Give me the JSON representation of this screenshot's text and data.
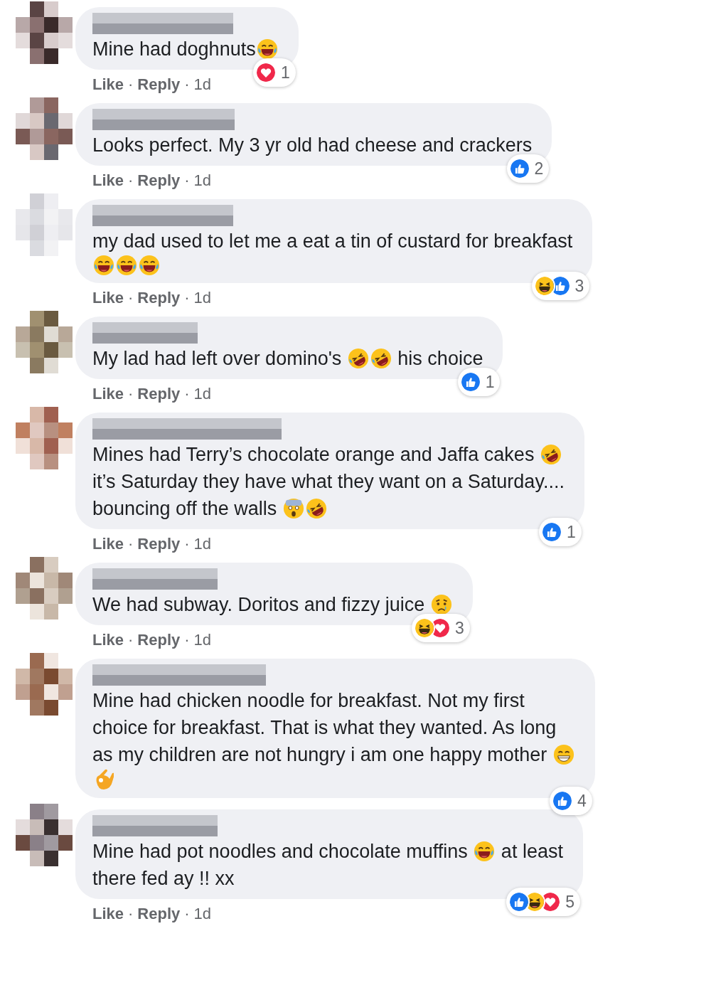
{
  "comments": [
    {
      "lines": [
        [
          {
            "kind": "text",
            "text": "Mine had doghnuts"
          },
          {
            "kind": "laugh"
          }
        ]
      ],
      "reactions": [
        {
          "kind": "love"
        }
      ],
      "count": "1",
      "meta": [
        {
          "kind": "link",
          "text": "Like"
        },
        {
          "kind": "sep",
          "text": "·"
        },
        {
          "kind": "link",
          "text": "Reply"
        },
        {
          "kind": "sep",
          "text": "·"
        },
        {
          "kind": "time",
          "text": "1d"
        }
      ]
    },
    {
      "lines": [
        [
          {
            "kind": "text",
            "text": "Looks perfect. My 3 yr old had cheese and crackers"
          }
        ]
      ],
      "reactions": [
        {
          "kind": "like"
        }
      ],
      "count": "2",
      "meta": [
        {
          "kind": "link",
          "text": "Like"
        },
        {
          "kind": "sep",
          "text": "·"
        },
        {
          "kind": "link",
          "text": "Reply"
        },
        {
          "kind": "sep",
          "text": "·"
        },
        {
          "kind": "time",
          "text": "1d"
        }
      ]
    },
    {
      "lines": [
        [
          {
            "kind": "text",
            "text": "my dad used to let me a eat a tin of custard for breakfast"
          }
        ],
        [
          {
            "kind": "laugh"
          },
          {
            "kind": "laugh"
          },
          {
            "kind": "laugh"
          }
        ]
      ],
      "reactions": [
        {
          "kind": "haha"
        },
        {
          "kind": "like"
        }
      ],
      "count": "3",
      "meta": [
        {
          "kind": "link",
          "text": "Like"
        },
        {
          "kind": "sep",
          "text": "·"
        },
        {
          "kind": "link",
          "text": "Reply"
        },
        {
          "kind": "sep",
          "text": "·"
        },
        {
          "kind": "time",
          "text": "1d"
        }
      ]
    },
    {
      "lines": [
        [
          {
            "kind": "text",
            "text": "My lad had left over domino's "
          },
          {
            "kind": "rofl"
          },
          {
            "kind": "rofl"
          },
          {
            "kind": "text",
            "text": " his choice"
          }
        ]
      ],
      "reactions": [
        {
          "kind": "like"
        }
      ],
      "count": "1",
      "meta": [
        {
          "kind": "link",
          "text": "Like"
        },
        {
          "kind": "sep",
          "text": "·"
        },
        {
          "kind": "link",
          "text": "Reply"
        },
        {
          "kind": "sep",
          "text": "·"
        },
        {
          "kind": "time",
          "text": "1d"
        }
      ]
    },
    {
      "lines": [
        [
          {
            "kind": "text",
            "text": "Mines had Terry’s chocolate orange and Jaffa cakes "
          },
          {
            "kind": "rofl"
          }
        ],
        [
          {
            "kind": "text",
            "text": "it’s Saturday they have what they want on a Saturday...."
          }
        ],
        [
          {
            "kind": "text",
            "text": "bouncing off the walls "
          },
          {
            "kind": "shocked"
          },
          {
            "kind": "rofl"
          }
        ]
      ],
      "reactions": [
        {
          "kind": "like"
        }
      ],
      "count": "1",
      "meta": [
        {
          "kind": "link",
          "text": "Like"
        },
        {
          "kind": "sep",
          "text": "·"
        },
        {
          "kind": "link",
          "text": "Reply"
        },
        {
          "kind": "sep",
          "text": "·"
        },
        {
          "kind": "time",
          "text": "1d"
        }
      ]
    },
    {
      "lines": [
        [
          {
            "kind": "text",
            "text": "We had subway. Doritos and fizzy juice "
          },
          {
            "kind": "sad"
          }
        ]
      ],
      "reactions": [
        {
          "kind": "haha"
        },
        {
          "kind": "love"
        }
      ],
      "count": "3",
      "meta": [
        {
          "kind": "link",
          "text": "Like"
        },
        {
          "kind": "sep",
          "text": "·"
        },
        {
          "kind": "link",
          "text": "Reply"
        },
        {
          "kind": "sep",
          "text": "·"
        },
        {
          "kind": "time",
          "text": "1d"
        }
      ]
    },
    {
      "lines": [
        [
          {
            "kind": "text",
            "text": "Mine had chicken noodle for breakfast. Not my first"
          }
        ],
        [
          {
            "kind": "text",
            "text": "choice for breakfast. That is what they wanted. As long"
          }
        ],
        [
          {
            "kind": "text",
            "text": "as my children are not hungry i am one happy mother "
          },
          {
            "kind": "grin"
          }
        ],
        [
          {
            "kind": "ok"
          }
        ]
      ],
      "reactions": [
        {
          "kind": "like"
        }
      ],
      "count": "4"
    },
    {
      "lines": [
        [
          {
            "kind": "text",
            "text": "Mine had pot noodles and chocolate muffins "
          },
          {
            "kind": "laugh"
          },
          {
            "kind": "text",
            "text": " at least"
          }
        ],
        [
          {
            "kind": "text",
            "text": "there fed ay !! xx"
          }
        ]
      ],
      "reactions": [
        {
          "kind": "like"
        },
        {
          "kind": "haha"
        },
        {
          "kind": "love"
        }
      ],
      "count": "5",
      "meta": [
        {
          "kind": "link",
          "text": "Like"
        },
        {
          "kind": "sep",
          "text": "·"
        },
        {
          "kind": "link",
          "text": "Reply"
        },
        {
          "kind": "sep",
          "text": "·"
        },
        {
          "kind": "time",
          "text": "1d"
        }
      ]
    }
  ]
}
